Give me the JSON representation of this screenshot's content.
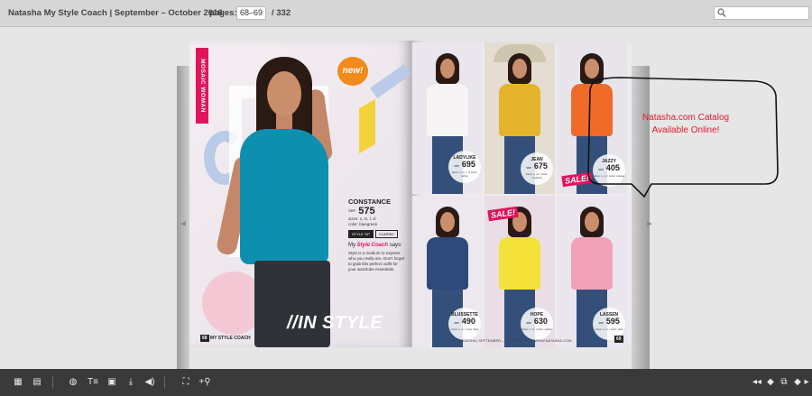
{
  "header": {
    "title": "Natasha My Style Coach  |  September – October 2016",
    "pages_label": "pages:",
    "current_pages": "68–69",
    "total_pages": "/ 332",
    "search_placeholder": ""
  },
  "left_page": {
    "section_tab": "MOSAIC WOMAN",
    "new_badge": "new!",
    "product": {
      "name": "CONSTANCE",
      "srp_label": "SRP",
      "price": "575",
      "sizes": "sizes: s, m, l, xl",
      "color": "color: bluegreen",
      "tags": [
        "STYLE TIP",
        "CLASSIC"
      ]
    },
    "style_coach_heading_prefix": "My",
    "style_coach_heading_brand": "Style Coach",
    "style_coach_heading_suffix": "says:",
    "style_coach_body": "Style is a medium to express who you really are. Don't forget to grab this perfect outfit for your wardrobe essentials.",
    "headline": "//IN STYLE",
    "folio_number": "68",
    "folio_brand": "MY STYLE COACH"
  },
  "right_page": {
    "products": [
      {
        "name": "LADYLIKE",
        "srp": "SRP",
        "price": "695",
        "details": "sizes: s, m, l, xl  color: white",
        "top_color": "#f6f4f4",
        "bg": "#e9e6ee",
        "sale": ""
      },
      {
        "name": "JEAN",
        "srp": "SRP",
        "price": "675",
        "details": "sizes: s, m, l  color: mustard",
        "top_color": "#e6b32c",
        "bg": "#e3ddd2",
        "sale": ""
      },
      {
        "name": "JAZZY",
        "srp": "SRP",
        "price": "405",
        "details": "sizes: s, m, l  color: orange",
        "top_color": "#f06a2a",
        "bg": "#e7e4ea",
        "sale": "SALE!"
      },
      {
        "name": "BLUSSETTE",
        "srp": "SRP",
        "price": "490",
        "details": "sizes: s, m, l  color: blue",
        "top_color": "#2e4a7a",
        "bg": "#ece8ee",
        "sale": ""
      },
      {
        "name": "HOPE",
        "srp": "SRP",
        "price": "630",
        "details": "sizes: s, m, l  color: yellow",
        "top_color": "#f4e23a",
        "bg": "#e9dde6",
        "sale": "SALE!",
        "was_label": "NOW: SRP"
      },
      {
        "name": "LASSEN",
        "srp": "SRP",
        "price": "595",
        "details": "sizes: s, m, l  color: pink",
        "top_color": "#f2a2b8",
        "bg": "#ebe6ee",
        "sale": ""
      }
    ],
    "folio_text": "NATASHA | SEPTEMBER – OCTOBER 2016 | WWW.NATASHA.COM",
    "folio_number": "69"
  },
  "callout": {
    "line1": "Natasha.com Catalog",
    "line2": "Available Online!",
    "text_color": "#e3182d"
  },
  "toolbar": {
    "left_buttons": [
      "thumbnails-icon",
      "bookmark-icon",
      "share-icon",
      "text-icon",
      "print-icon",
      "download-icon",
      "sound-icon",
      "fullscreen-icon",
      "zoom-icon"
    ],
    "right_buttons": [
      "first-page-icon",
      "previous-page-icon",
      "two-page-icon",
      "next-page-icon",
      "last-page-icon"
    ]
  }
}
